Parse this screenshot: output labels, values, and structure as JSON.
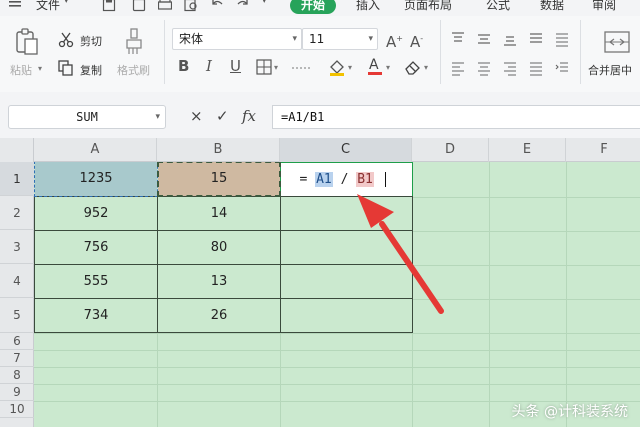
{
  "menu": {
    "file": "文件",
    "tabs": [
      {
        "label": "开始",
        "active": true
      },
      {
        "label": "插入",
        "active": false
      },
      {
        "label": "页面布局",
        "active": false
      },
      {
        "label": "公式",
        "active": false
      },
      {
        "label": "数据",
        "active": false
      },
      {
        "label": "审阅",
        "active": false
      }
    ]
  },
  "ribbon": {
    "paste": "粘贴",
    "cut": "剪切",
    "copy": "复制",
    "format_painter": "格式刷",
    "font_name": "宋体",
    "font_size": "11",
    "merge_center": "合并居中"
  },
  "formula_bar": {
    "name_box": "SUM",
    "cancel_glyph": "×",
    "confirm_glyph": "✓",
    "fx_glyph": "fx",
    "formula": "=A1/B1"
  },
  "grid": {
    "columns": [
      "A",
      "B",
      "C",
      "D",
      "E",
      "F"
    ],
    "rows": [
      "1",
      "2",
      "3",
      "4",
      "5",
      "6",
      "7",
      "8",
      "9",
      "10"
    ],
    "col_a_values": [
      "1235",
      "952",
      "756",
      "555",
      "734"
    ],
    "col_b_values": [
      "15",
      "14",
      "80",
      "13",
      "26"
    ],
    "edit_cell": {
      "equals": "=",
      "ref_a": "A1",
      "slash": "/",
      "ref_b": "B1"
    }
  },
  "colors": {
    "accent_green": "#27a35a",
    "sheet_bg": "#cbe9cf",
    "arrow_red": "#e53935"
  },
  "watermark": "头条 @计科装系统"
}
